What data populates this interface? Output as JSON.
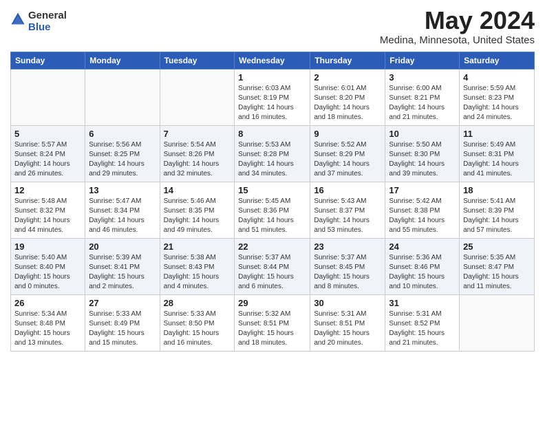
{
  "header": {
    "logo_general": "General",
    "logo_blue": "Blue",
    "month_title": "May 2024",
    "location": "Medina, Minnesota, United States"
  },
  "weekdays": [
    "Sunday",
    "Monday",
    "Tuesday",
    "Wednesday",
    "Thursday",
    "Friday",
    "Saturday"
  ],
  "weeks": [
    [
      {
        "day": "",
        "info": ""
      },
      {
        "day": "",
        "info": ""
      },
      {
        "day": "",
        "info": ""
      },
      {
        "day": "1",
        "info": "Sunrise: 6:03 AM\nSunset: 8:19 PM\nDaylight: 14 hours\nand 16 minutes."
      },
      {
        "day": "2",
        "info": "Sunrise: 6:01 AM\nSunset: 8:20 PM\nDaylight: 14 hours\nand 18 minutes."
      },
      {
        "day": "3",
        "info": "Sunrise: 6:00 AM\nSunset: 8:21 PM\nDaylight: 14 hours\nand 21 minutes."
      },
      {
        "day": "4",
        "info": "Sunrise: 5:59 AM\nSunset: 8:23 PM\nDaylight: 14 hours\nand 24 minutes."
      }
    ],
    [
      {
        "day": "5",
        "info": "Sunrise: 5:57 AM\nSunset: 8:24 PM\nDaylight: 14 hours\nand 26 minutes."
      },
      {
        "day": "6",
        "info": "Sunrise: 5:56 AM\nSunset: 8:25 PM\nDaylight: 14 hours\nand 29 minutes."
      },
      {
        "day": "7",
        "info": "Sunrise: 5:54 AM\nSunset: 8:26 PM\nDaylight: 14 hours\nand 32 minutes."
      },
      {
        "day": "8",
        "info": "Sunrise: 5:53 AM\nSunset: 8:28 PM\nDaylight: 14 hours\nand 34 minutes."
      },
      {
        "day": "9",
        "info": "Sunrise: 5:52 AM\nSunset: 8:29 PM\nDaylight: 14 hours\nand 37 minutes."
      },
      {
        "day": "10",
        "info": "Sunrise: 5:50 AM\nSunset: 8:30 PM\nDaylight: 14 hours\nand 39 minutes."
      },
      {
        "day": "11",
        "info": "Sunrise: 5:49 AM\nSunset: 8:31 PM\nDaylight: 14 hours\nand 41 minutes."
      }
    ],
    [
      {
        "day": "12",
        "info": "Sunrise: 5:48 AM\nSunset: 8:32 PM\nDaylight: 14 hours\nand 44 minutes."
      },
      {
        "day": "13",
        "info": "Sunrise: 5:47 AM\nSunset: 8:34 PM\nDaylight: 14 hours\nand 46 minutes."
      },
      {
        "day": "14",
        "info": "Sunrise: 5:46 AM\nSunset: 8:35 PM\nDaylight: 14 hours\nand 49 minutes."
      },
      {
        "day": "15",
        "info": "Sunrise: 5:45 AM\nSunset: 8:36 PM\nDaylight: 14 hours\nand 51 minutes."
      },
      {
        "day": "16",
        "info": "Sunrise: 5:43 AM\nSunset: 8:37 PM\nDaylight: 14 hours\nand 53 minutes."
      },
      {
        "day": "17",
        "info": "Sunrise: 5:42 AM\nSunset: 8:38 PM\nDaylight: 14 hours\nand 55 minutes."
      },
      {
        "day": "18",
        "info": "Sunrise: 5:41 AM\nSunset: 8:39 PM\nDaylight: 14 hours\nand 57 minutes."
      }
    ],
    [
      {
        "day": "19",
        "info": "Sunrise: 5:40 AM\nSunset: 8:40 PM\nDaylight: 15 hours\nand 0 minutes."
      },
      {
        "day": "20",
        "info": "Sunrise: 5:39 AM\nSunset: 8:41 PM\nDaylight: 15 hours\nand 2 minutes."
      },
      {
        "day": "21",
        "info": "Sunrise: 5:38 AM\nSunset: 8:43 PM\nDaylight: 15 hours\nand 4 minutes."
      },
      {
        "day": "22",
        "info": "Sunrise: 5:37 AM\nSunset: 8:44 PM\nDaylight: 15 hours\nand 6 minutes."
      },
      {
        "day": "23",
        "info": "Sunrise: 5:37 AM\nSunset: 8:45 PM\nDaylight: 15 hours\nand 8 minutes."
      },
      {
        "day": "24",
        "info": "Sunrise: 5:36 AM\nSunset: 8:46 PM\nDaylight: 15 hours\nand 10 minutes."
      },
      {
        "day": "25",
        "info": "Sunrise: 5:35 AM\nSunset: 8:47 PM\nDaylight: 15 hours\nand 11 minutes."
      }
    ],
    [
      {
        "day": "26",
        "info": "Sunrise: 5:34 AM\nSunset: 8:48 PM\nDaylight: 15 hours\nand 13 minutes."
      },
      {
        "day": "27",
        "info": "Sunrise: 5:33 AM\nSunset: 8:49 PM\nDaylight: 15 hours\nand 15 minutes."
      },
      {
        "day": "28",
        "info": "Sunrise: 5:33 AM\nSunset: 8:50 PM\nDaylight: 15 hours\nand 16 minutes."
      },
      {
        "day": "29",
        "info": "Sunrise: 5:32 AM\nSunset: 8:51 PM\nDaylight: 15 hours\nand 18 minutes."
      },
      {
        "day": "30",
        "info": "Sunrise: 5:31 AM\nSunset: 8:51 PM\nDaylight: 15 hours\nand 20 minutes."
      },
      {
        "day": "31",
        "info": "Sunrise: 5:31 AM\nSunset: 8:52 PM\nDaylight: 15 hours\nand 21 minutes."
      },
      {
        "day": "",
        "info": ""
      }
    ]
  ]
}
